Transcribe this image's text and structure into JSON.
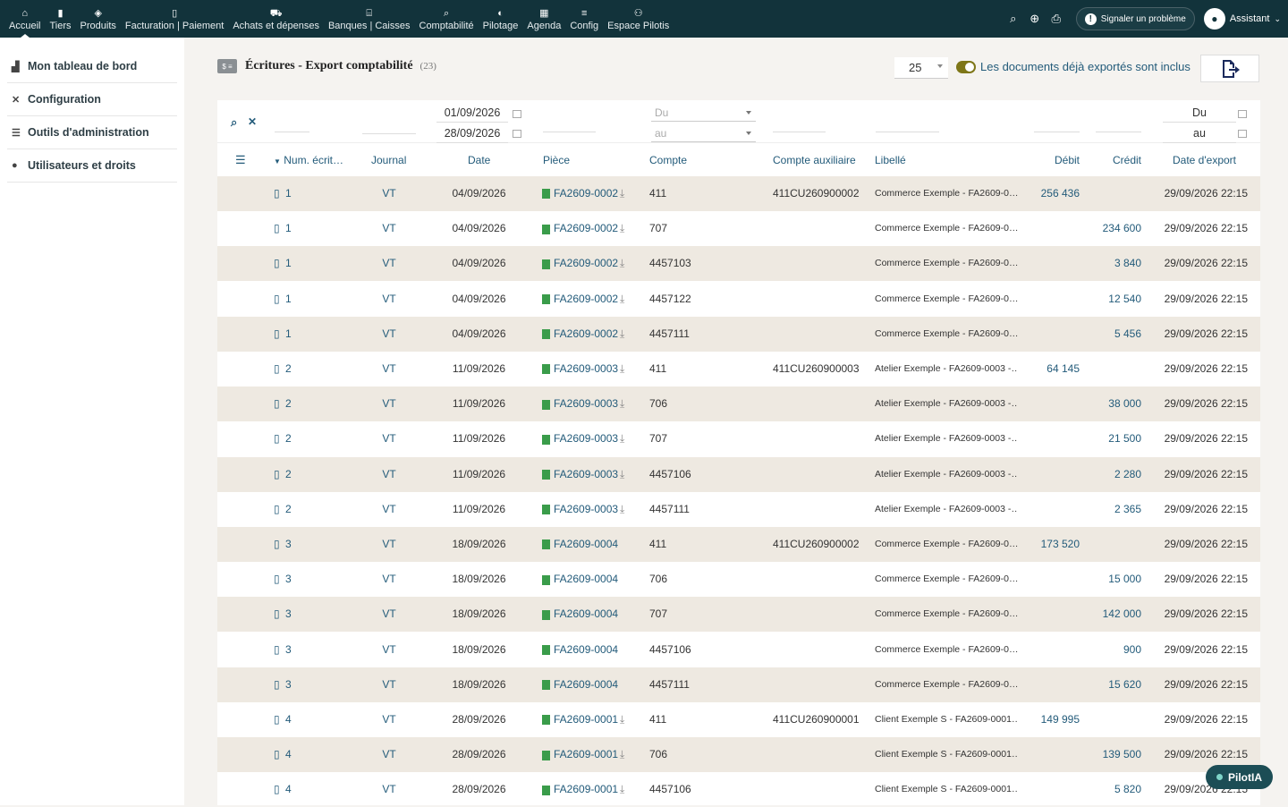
{
  "topnav": {
    "items": [
      {
        "label": "Accueil",
        "icon": "home-icon",
        "glyph": "⌂"
      },
      {
        "label": "Tiers",
        "icon": "building-icon",
        "glyph": "▮"
      },
      {
        "label": "Produits",
        "icon": "cube-icon",
        "glyph": "◈"
      },
      {
        "label": "Facturation | Paiement",
        "icon": "invoice-icon",
        "glyph": "▯"
      },
      {
        "label": "Achats et dépenses",
        "icon": "cart-icon",
        "glyph": "⛟"
      },
      {
        "label": "Banques | Caisses",
        "icon": "bank-icon",
        "glyph": "⌸"
      },
      {
        "label": "Comptabilité",
        "icon": "search-dollar-icon",
        "glyph": "⌕"
      },
      {
        "label": "Pilotage",
        "icon": "gauge-icon",
        "glyph": "◐"
      },
      {
        "label": "Agenda",
        "icon": "calendar-icon",
        "glyph": "▦"
      },
      {
        "label": "Config",
        "icon": "sliders-icon",
        "glyph": "≡"
      },
      {
        "label": "Espace Pilotis",
        "icon": "users-icon",
        "glyph": "⚇"
      }
    ],
    "report_label": "Signaler un problème",
    "user_label": "Assistant"
  },
  "sidebar": {
    "items": [
      {
        "label": "Mon tableau de bord",
        "icon": "chart-icon",
        "glyph": "▟"
      },
      {
        "label": "Configuration",
        "icon": "tools-icon",
        "glyph": "✕"
      },
      {
        "label": "Outils d'administration",
        "icon": "server-icon",
        "glyph": "☰"
      },
      {
        "label": "Utilisateurs et droits",
        "icon": "user-icon",
        "glyph": "●"
      }
    ]
  },
  "page": {
    "title": "Écritures - Export comptabilité",
    "count": "(23)",
    "per_page": "25",
    "toggle_label": "Les documents déjà exportés sont inclus",
    "toggle_on": true
  },
  "filters": {
    "date_from": "01/09/2026",
    "date_to": "28/09/2026",
    "compte_from": "Du",
    "compte_to": "au",
    "export_from": "Du",
    "export_to": "au"
  },
  "columns": {
    "num": "Num. écrit…",
    "journal": "Journal",
    "date": "Date",
    "piece": "Pièce",
    "compte": "Compte",
    "aux": "Compte auxiliaire",
    "libelle": "Libellé",
    "debit": "Débit",
    "credit": "Crédit",
    "export": "Date d'export"
  },
  "rows": [
    {
      "num": "1",
      "journal": "VT",
      "date": "04/09/2026",
      "piece": "FA2609-0002",
      "dl": true,
      "compte": "411",
      "aux": "411CU260900002",
      "libelle": "Commerce Exemple - FA2609-0…",
      "debit": "256 436",
      "credit": "",
      "export": "29/09/2026 22:15"
    },
    {
      "num": "1",
      "journal": "VT",
      "date": "04/09/2026",
      "piece": "FA2609-0002",
      "dl": true,
      "compte": "707",
      "aux": "",
      "libelle": "Commerce Exemple - FA2609-0…",
      "debit": "",
      "credit": "234 600",
      "export": "29/09/2026 22:15"
    },
    {
      "num": "1",
      "journal": "VT",
      "date": "04/09/2026",
      "piece": "FA2609-0002",
      "dl": true,
      "compte": "4457103",
      "aux": "",
      "libelle": "Commerce Exemple - FA2609-0…",
      "debit": "",
      "credit": "3 840",
      "export": "29/09/2026 22:15"
    },
    {
      "num": "1",
      "journal": "VT",
      "date": "04/09/2026",
      "piece": "FA2609-0002",
      "dl": true,
      "compte": "4457122",
      "aux": "",
      "libelle": "Commerce Exemple - FA2609-0…",
      "debit": "",
      "credit": "12 540",
      "export": "29/09/2026 22:15"
    },
    {
      "num": "1",
      "journal": "VT",
      "date": "04/09/2026",
      "piece": "FA2609-0002",
      "dl": true,
      "compte": "4457111",
      "aux": "",
      "libelle": "Commerce Exemple - FA2609-0…",
      "debit": "",
      "credit": "5 456",
      "export": "29/09/2026 22:15"
    },
    {
      "num": "2",
      "journal": "VT",
      "date": "11/09/2026",
      "piece": "FA2609-0003",
      "dl": true,
      "compte": "411",
      "aux": "411CU260900003",
      "libelle": "Atelier Exemple - FA2609-0003 -…",
      "debit": "64 145",
      "credit": "",
      "export": "29/09/2026 22:15"
    },
    {
      "num": "2",
      "journal": "VT",
      "date": "11/09/2026",
      "piece": "FA2609-0003",
      "dl": true,
      "compte": "706",
      "aux": "",
      "libelle": "Atelier Exemple - FA2609-0003 -…",
      "debit": "",
      "credit": "38 000",
      "export": "29/09/2026 22:15"
    },
    {
      "num": "2",
      "journal": "VT",
      "date": "11/09/2026",
      "piece": "FA2609-0003",
      "dl": true,
      "compte": "707",
      "aux": "",
      "libelle": "Atelier Exemple - FA2609-0003 -…",
      "debit": "",
      "credit": "21 500",
      "export": "29/09/2026 22:15"
    },
    {
      "num": "2",
      "journal": "VT",
      "date": "11/09/2026",
      "piece": "FA2609-0003",
      "dl": true,
      "compte": "4457106",
      "aux": "",
      "libelle": "Atelier Exemple - FA2609-0003 -…",
      "debit": "",
      "credit": "2 280",
      "export": "29/09/2026 22:15"
    },
    {
      "num": "2",
      "journal": "VT",
      "date": "11/09/2026",
      "piece": "FA2609-0003",
      "dl": true,
      "compte": "4457111",
      "aux": "",
      "libelle": "Atelier Exemple - FA2609-0003 -…",
      "debit": "",
      "credit": "2 365",
      "export": "29/09/2026 22:15"
    },
    {
      "num": "3",
      "journal": "VT",
      "date": "18/09/2026",
      "piece": "FA2609-0004",
      "dl": false,
      "compte": "411",
      "aux": "411CU260900002",
      "libelle": "Commerce Exemple - FA2609-0…",
      "debit": "173 520",
      "credit": "",
      "export": "29/09/2026 22:15"
    },
    {
      "num": "3",
      "journal": "VT",
      "date": "18/09/2026",
      "piece": "FA2609-0004",
      "dl": false,
      "compte": "706",
      "aux": "",
      "libelle": "Commerce Exemple - FA2609-0…",
      "debit": "",
      "credit": "15 000",
      "export": "29/09/2026 22:15"
    },
    {
      "num": "3",
      "journal": "VT",
      "date": "18/09/2026",
      "piece": "FA2609-0004",
      "dl": false,
      "compte": "707",
      "aux": "",
      "libelle": "Commerce Exemple - FA2609-0…",
      "debit": "",
      "credit": "142 000",
      "export": "29/09/2026 22:15"
    },
    {
      "num": "3",
      "journal": "VT",
      "date": "18/09/2026",
      "piece": "FA2609-0004",
      "dl": false,
      "compte": "4457106",
      "aux": "",
      "libelle": "Commerce Exemple - FA2609-0…",
      "debit": "",
      "credit": "900",
      "export": "29/09/2026 22:15"
    },
    {
      "num": "3",
      "journal": "VT",
      "date": "18/09/2026",
      "piece": "FA2609-0004",
      "dl": false,
      "compte": "4457111",
      "aux": "",
      "libelle": "Commerce Exemple - FA2609-0…",
      "debit": "",
      "credit": "15 620",
      "export": "29/09/2026 22:15"
    },
    {
      "num": "4",
      "journal": "VT",
      "date": "28/09/2026",
      "piece": "FA2609-0001",
      "dl": true,
      "compte": "411",
      "aux": "411CU260900001",
      "libelle": "Client Exemple S - FA2609-0001…",
      "debit": "149 995",
      "credit": "",
      "export": "29/09/2026 22:15"
    },
    {
      "num": "4",
      "journal": "VT",
      "date": "28/09/2026",
      "piece": "FA2609-0001",
      "dl": true,
      "compte": "706",
      "aux": "",
      "libelle": "Client Exemple S - FA2609-0001…",
      "debit": "",
      "credit": "139 500",
      "export": "29/09/2026 22:15"
    },
    {
      "num": "4",
      "journal": "VT",
      "date": "28/09/2026",
      "piece": "FA2609-0001",
      "dl": true,
      "compte": "4457106",
      "aux": "",
      "libelle": "Client Exemple S - FA2609-0001…",
      "debit": "",
      "credit": "5 820",
      "export": "29/09/2026 22:15"
    }
  ],
  "pilotia_label": "PilotIA",
  "colors": {
    "topbar": "#12333b",
    "link": "#235b7a",
    "row_alt": "#eee9e1",
    "toggle": "#7e7618"
  }
}
